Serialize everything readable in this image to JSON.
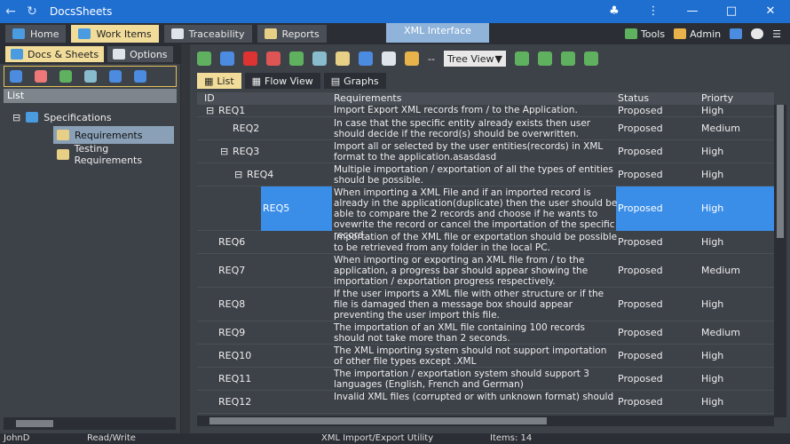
{
  "app": {
    "title": "DocsSheets"
  },
  "main_tabs": [
    {
      "label": "Home"
    },
    {
      "label": "Work Items"
    },
    {
      "label": "Traceability"
    },
    {
      "label": "Reports"
    }
  ],
  "context_tab": "XML Interface",
  "menu": {
    "tools": "Tools",
    "admin": "Admin"
  },
  "left": {
    "tabs": [
      {
        "label": "Docs & Sheets"
      },
      {
        "label": "Options"
      }
    ],
    "list_header": "List",
    "tree": {
      "root": "Specifications",
      "children": [
        "Requirements",
        "Testing Requirements"
      ]
    }
  },
  "main": {
    "tree_view": "Tree View",
    "dash": "--",
    "view_tabs": [
      {
        "label": "List"
      },
      {
        "label": "Flow View"
      },
      {
        "label": "Graphs"
      }
    ],
    "columns": {
      "id": "ID",
      "req": "Requirements",
      "status": "Status",
      "priority": "Priorty"
    },
    "rows": [
      {
        "id": "REQ1",
        "req": "Import Export XML records from / to the Application.",
        "status": "Proposed",
        "priority": "High"
      },
      {
        "id": "REQ2",
        "req": "In case that the specific entity already exists then user should decide if the record(s) should be overwritten.",
        "status": "Proposed",
        "priority": "Medium"
      },
      {
        "id": "REQ3",
        "req": "Import all or selected by the user entities(records) in XML format  to the application.asasdasd",
        "status": "Proposed",
        "priority": "High"
      },
      {
        "id": "REQ4",
        "req": "Multiple importation / exportation of all the types of entities should be possible.",
        "status": "Proposed",
        "priority": "High"
      },
      {
        "id": "REQ5",
        "req": "When importing a XML File and if an imported record is already in the application(duplicate) then the user should be able to compare the 2 records and choose if he wants to ovewrite the record or cancel the importation of the specific record.",
        "status": "Proposed",
        "priority": "High"
      },
      {
        "id": "REQ6",
        "req": "Importation of the XML file or exportation should be possible to be retrieved from any folder in the local PC.",
        "status": "Proposed",
        "priority": "High"
      },
      {
        "id": "REQ7",
        "req": "When importing or exporting an XML file from / to the application, a progress bar should appear showing the importation / exportation progress respectively.",
        "status": "Proposed",
        "priority": "Medium"
      },
      {
        "id": "REQ8",
        "req": "If the user imports a XML file with other structure or if the file is damaged then a message box should appear preventing the user import this file.",
        "status": "Proposed",
        "priority": "High"
      },
      {
        "id": "REQ9",
        "req": "The importation of an XML file containing 100 records should not take more than 2 seconds.",
        "status": "Proposed",
        "priority": "Medium"
      },
      {
        "id": "REQ10",
        "req": "The XML importing system should not support importation of other file types except .XML",
        "status": "Proposed",
        "priority": "High"
      },
      {
        "id": "REQ11",
        "req": "The importation / exportation system should support 3 languages (English, French and German)",
        "status": "Proposed",
        "priority": "High"
      },
      {
        "id": "REQ12",
        "req": "Invalid XML files (corrupted or with unknown format) should",
        "status": "Proposed",
        "priority": "High"
      }
    ]
  },
  "status": {
    "user": "JohnD",
    "mode": "Read/Write",
    "utility": "XML Import/Export Utility",
    "items": "Items: 14"
  }
}
